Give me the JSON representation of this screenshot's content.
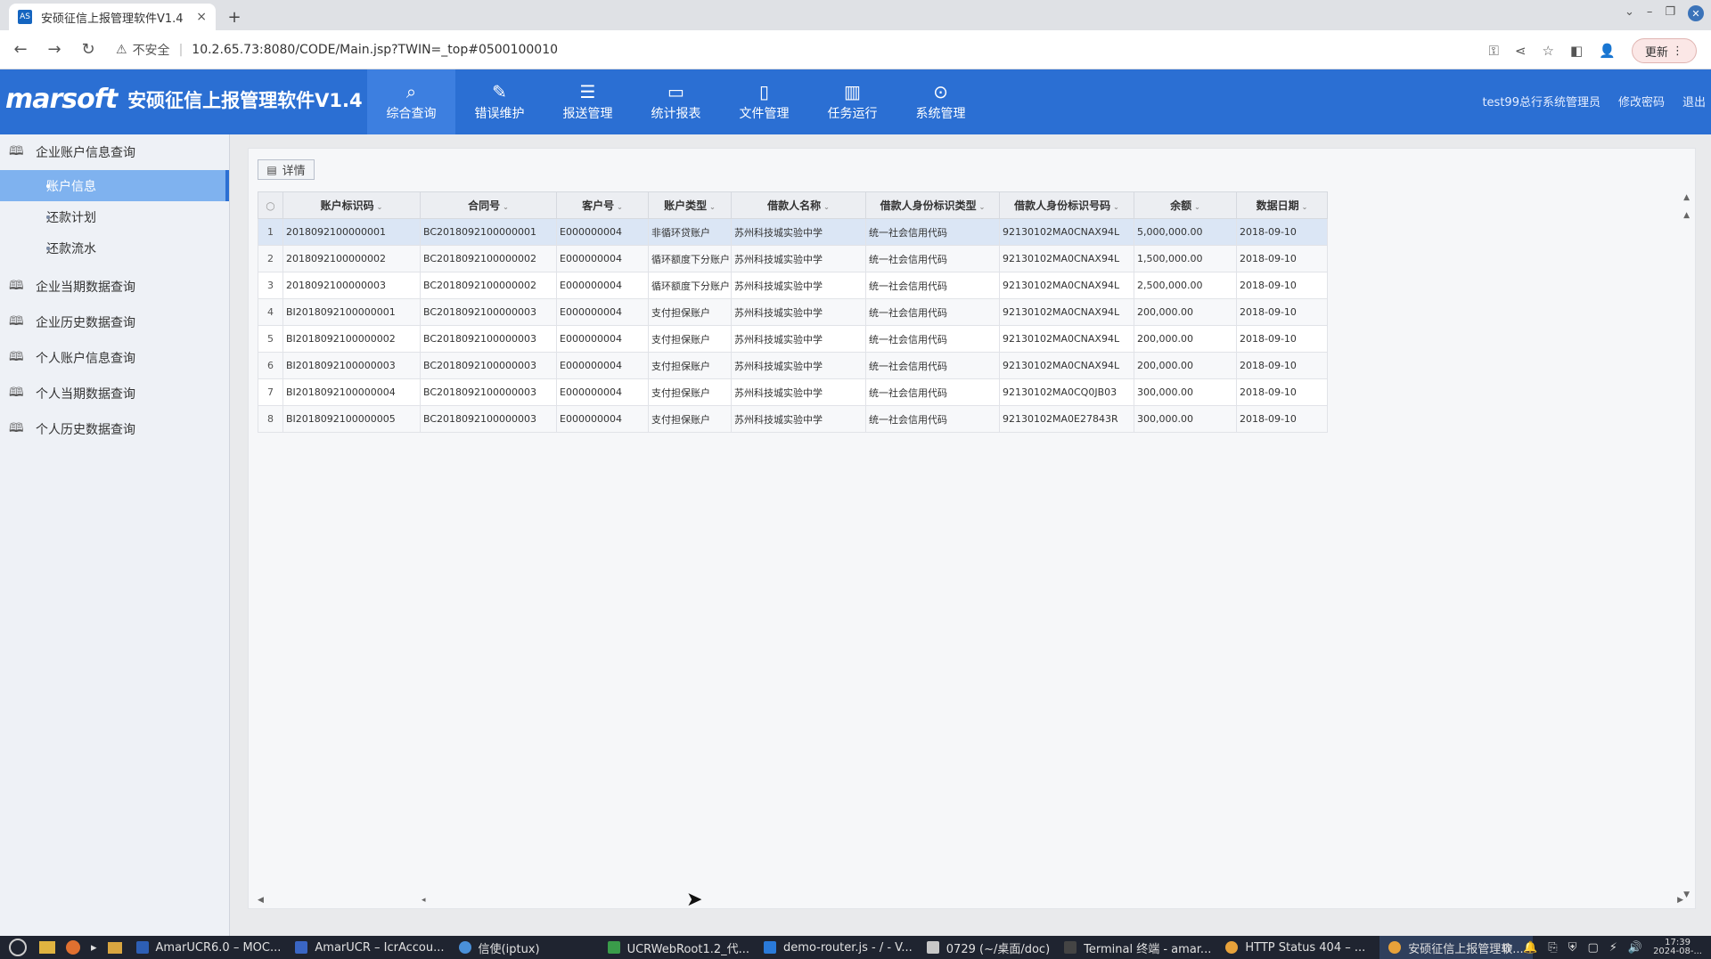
{
  "browser": {
    "tab_title": "安硕征信上报管理软件V1.4",
    "tab_favicon": "AS",
    "tab_close": "×",
    "new_tab": "+",
    "security_label": "不安全",
    "url": "10.2.65.73:8080/CODE/Main.jsp?TWIN=_top#0500100010",
    "update_label": "更新"
  },
  "app": {
    "logo_text": "marsoft",
    "title": "安硕征信上报管理软件V1.4",
    "nav": [
      {
        "label": "综合查询",
        "icon": "search-doc-icon"
      },
      {
        "label": "错误维护",
        "icon": "edit-icon"
      },
      {
        "label": "报送管理",
        "icon": "layers-icon"
      },
      {
        "label": "统计报表",
        "icon": "folder-icon"
      },
      {
        "label": "文件管理",
        "icon": "book-icon"
      },
      {
        "label": "任务运行",
        "icon": "book-open-icon"
      },
      {
        "label": "系统管理",
        "icon": "location-shield-icon"
      }
    ],
    "user": "test99总行系统管理员",
    "change_password": "修改密码",
    "logout": "退出"
  },
  "sidebar": {
    "groups": [
      {
        "label": "企业账户信息查询"
      },
      {
        "label": "企业当期数据查询"
      },
      {
        "label": "企业历史数据查询"
      },
      {
        "label": "个人账户信息查询"
      },
      {
        "label": "个人当期数据查询"
      },
      {
        "label": "个人历史数据查询"
      }
    ],
    "subitems": [
      {
        "label": "账户信息"
      },
      {
        "label": "还款计划"
      },
      {
        "label": "还款流水"
      }
    ]
  },
  "toolbar": {
    "detail_label": "详情"
  },
  "table": {
    "headers": [
      "账户标识码",
      "合同号",
      "客户号",
      "账户类型",
      "借款人名称",
      "借款人身份标识类型",
      "借款人身份标识号码",
      "余额",
      "数据日期"
    ],
    "rows": [
      [
        "1",
        "2018092100000001",
        "BC2018092100000001",
        "E000000004",
        "非循环贷账户",
        "苏州科技城实验中学",
        "统一社会信用代码",
        "92130102MA0CNAX94L",
        "5,000,000.00",
        "2018-09-10"
      ],
      [
        "2",
        "2018092100000002",
        "BC2018092100000002",
        "E000000004",
        "循环额度下分账户",
        "苏州科技城实验中学",
        "统一社会信用代码",
        "92130102MA0CNAX94L",
        "1,500,000.00",
        "2018-09-10"
      ],
      [
        "3",
        "2018092100000003",
        "BC2018092100000002",
        "E000000004",
        "循环额度下分账户",
        "苏州科技城实验中学",
        "统一社会信用代码",
        "92130102MA0CNAX94L",
        "2,500,000.00",
        "2018-09-10"
      ],
      [
        "4",
        "BI2018092100000001",
        "BC2018092100000003",
        "E000000004",
        "支付担保账户",
        "苏州科技城实验中学",
        "统一社会信用代码",
        "92130102MA0CNAX94L",
        "200,000.00",
        "2018-09-10"
      ],
      [
        "5",
        "BI2018092100000002",
        "BC2018092100000003",
        "E000000004",
        "支付担保账户",
        "苏州科技城实验中学",
        "统一社会信用代码",
        "92130102MA0CNAX94L",
        "200,000.00",
        "2018-09-10"
      ],
      [
        "6",
        "BI2018092100000003",
        "BC2018092100000003",
        "E000000004",
        "支付担保账户",
        "苏州科技城实验中学",
        "统一社会信用代码",
        "92130102MA0CNAX94L",
        "200,000.00",
        "2018-09-10"
      ],
      [
        "7",
        "BI2018092100000004",
        "BC2018092100000003",
        "E000000004",
        "支付担保账户",
        "苏州科技城实验中学",
        "统一社会信用代码",
        "92130102MA0CQ0JB03",
        "300,000.00",
        "2018-09-10"
      ],
      [
        "8",
        "BI2018092100000005",
        "BC2018092100000003",
        "E000000004",
        "支付担保账户",
        "苏州科技城实验中学",
        "统一社会信用代码",
        "92130102MA0E27843R",
        "300,000.00",
        "2018-09-10"
      ]
    ]
  },
  "taskbar": {
    "items": [
      {
        "label": "AmarUCR6.0 – MOC...",
        "color": "#2d5fb5"
      },
      {
        "label": "AmarUCR – IcrAccou...",
        "color": "#3a66c4"
      },
      {
        "label": "信使(iptux)",
        "color": "#4a90d9"
      },
      {
        "label": "UCRWebRoot1.2_代...",
        "color": "#3a9c4a"
      },
      {
        "label": "demo-router.js - / - V...",
        "color": "#2a7ad9"
      },
      {
        "label": "0729 (~/桌面/doc)",
        "color": "#c7c7c7"
      },
      {
        "label": "Terminal 终端 - amar...",
        "color": "#444444"
      },
      {
        "label": "HTTP Status 404 – ...",
        "color": "#e8a23a"
      },
      {
        "label": "安硕征信上报管理软...",
        "color": "#e8a23a"
      }
    ],
    "clock_time": "17:39",
    "clock_date": "2024-08-..."
  }
}
